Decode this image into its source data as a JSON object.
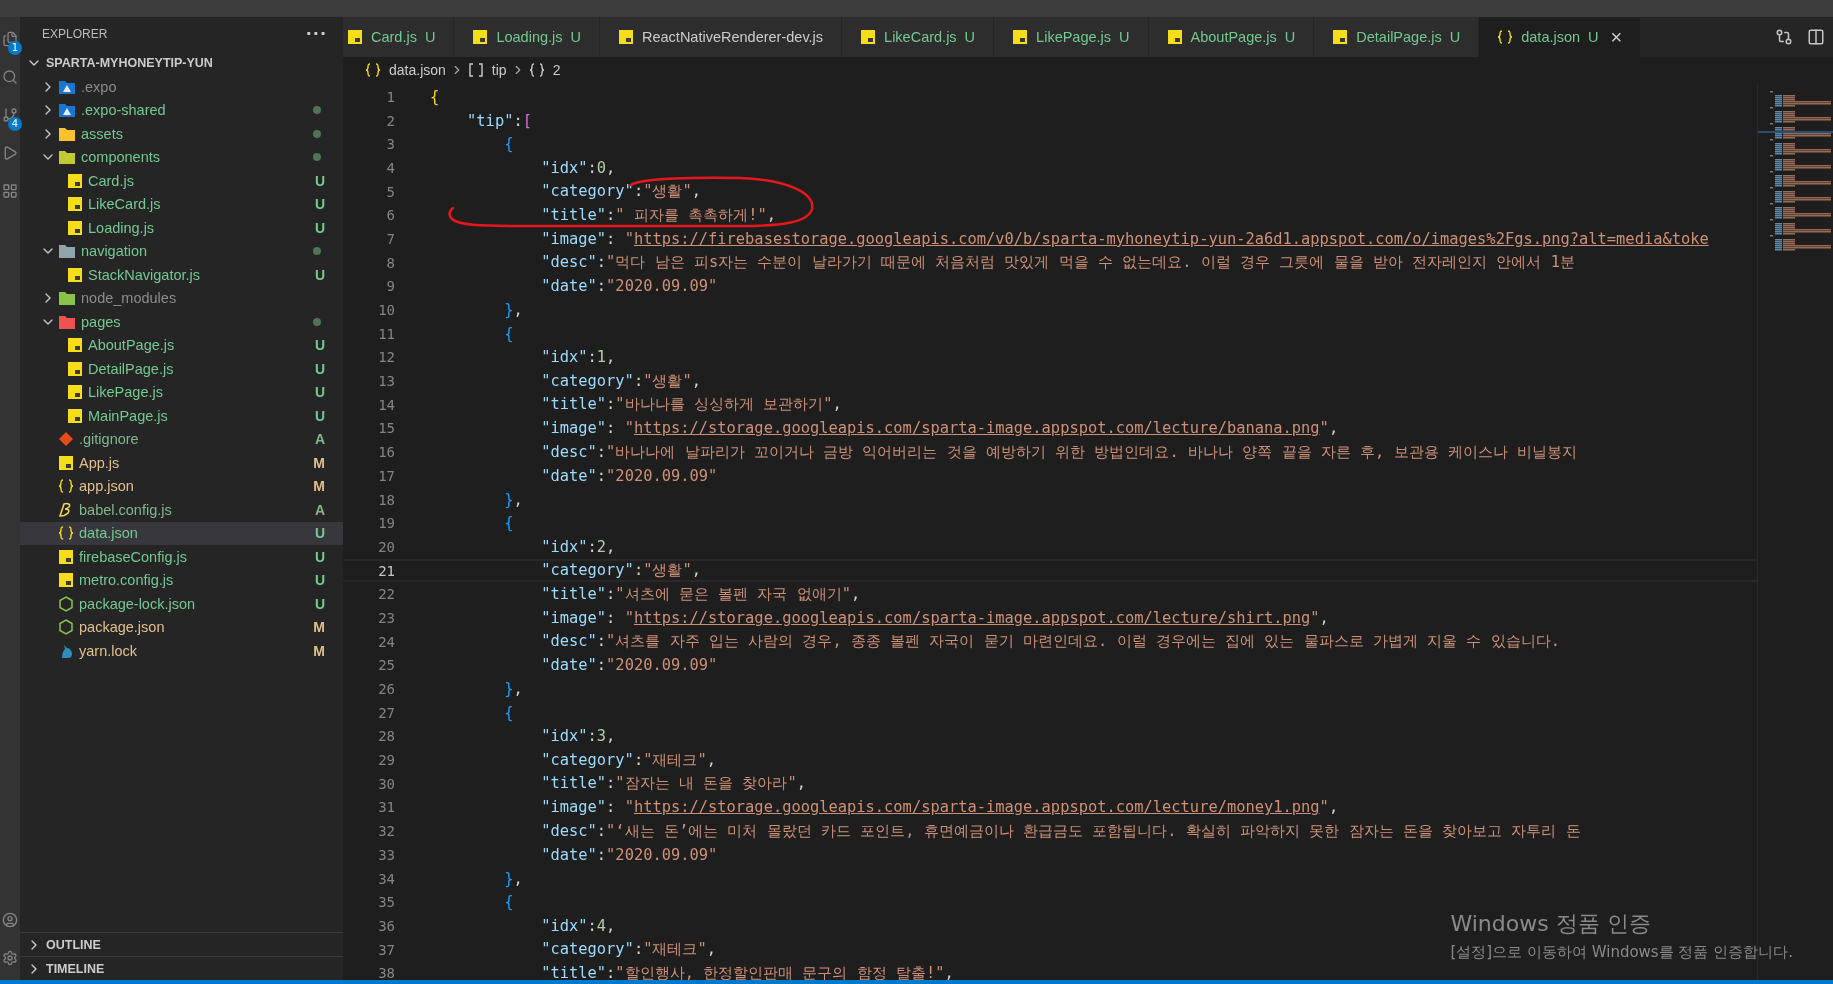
{
  "activity_bar": {
    "badges": [
      "1",
      "4"
    ]
  },
  "explorer": {
    "title": "EXPLORER",
    "more": "···",
    "project": {
      "name": "SPARTA-MYHONEYTIP-YUN",
      "expanded": true
    },
    "tree": [
      {
        "name": ".expo",
        "kind": "folder",
        "expanded": false,
        "color": "#8c8c8c",
        "dot": false,
        "selected": false
      },
      {
        "name": ".expo-shared",
        "kind": "folder",
        "expanded": false,
        "color": "#73c991",
        "dot": true,
        "selected": false
      },
      {
        "name": "assets",
        "kind": "folder",
        "expanded": false,
        "color": "#73c991",
        "dot": true,
        "selected": false
      },
      {
        "name": "components",
        "kind": "folder",
        "expanded": true,
        "color": "#73c991",
        "dot": true,
        "selected": false,
        "children": [
          {
            "name": "Card.js",
            "kind": "js",
            "color": "#73c991",
            "status": "U",
            "selected": false
          },
          {
            "name": "LikeCard.js",
            "kind": "js",
            "color": "#73c991",
            "status": "U",
            "selected": false
          },
          {
            "name": "Loading.js",
            "kind": "js",
            "color": "#73c991",
            "status": "U",
            "selected": false
          }
        ]
      },
      {
        "name": "navigation",
        "kind": "folder",
        "expanded": true,
        "color": "#73c991",
        "dot": true,
        "selected": false,
        "children": [
          {
            "name": "StackNavigator.js",
            "kind": "js",
            "color": "#73c991",
            "status": "U",
            "selected": false
          }
        ]
      },
      {
        "name": "node_modules",
        "kind": "folder",
        "expanded": false,
        "color": "#8c8c8c",
        "dot": false,
        "selected": false
      },
      {
        "name": "pages",
        "kind": "folder",
        "expanded": true,
        "color": "#73c991",
        "dot": true,
        "selected": false,
        "children": [
          {
            "name": "AboutPage.js",
            "kind": "js",
            "color": "#73c991",
            "status": "U",
            "selected": false
          },
          {
            "name": "DetailPage.js",
            "kind": "js",
            "color": "#73c991",
            "status": "U",
            "selected": false
          },
          {
            "name": "LikePage.js",
            "kind": "js",
            "color": "#73c991",
            "status": "U",
            "selected": false
          },
          {
            "name": "MainPage.js",
            "kind": "js",
            "color": "#73c991",
            "status": "U",
            "selected": false
          }
        ]
      },
      {
        "name": ".gitignore",
        "kind": "git",
        "color": "#81b88b",
        "status": "A",
        "selected": false
      },
      {
        "name": "App.js",
        "kind": "js",
        "color": "#e2c08d",
        "status": "M",
        "selected": false
      },
      {
        "name": "app.json",
        "kind": "json",
        "color": "#e2c08d",
        "status": "M",
        "selected": false
      },
      {
        "name": "babel.config.js",
        "kind": "babel",
        "color": "#81b88b",
        "status": "A",
        "selected": false
      },
      {
        "name": "data.json",
        "kind": "json",
        "color": "#73c991",
        "status": "U",
        "selected": true
      },
      {
        "name": "firebaseConfig.js",
        "kind": "js",
        "color": "#73c991",
        "status": "U",
        "selected": false
      },
      {
        "name": "metro.config.js",
        "kind": "js",
        "color": "#73c991",
        "status": "U",
        "selected": false
      },
      {
        "name": "package-lock.json",
        "kind": "npm",
        "color": "#73c991",
        "status": "U",
        "selected": false
      },
      {
        "name": "package.json",
        "kind": "npm",
        "color": "#e2c08d",
        "status": "M",
        "selected": false
      },
      {
        "name": "yarn.lock",
        "kind": "yarn",
        "color": "#e2c08d",
        "status": "M",
        "selected": false
      }
    ],
    "sections": [
      {
        "title": "OUTLINE",
        "expanded": false
      },
      {
        "title": "TIMELINE",
        "expanded": false
      }
    ]
  },
  "tabs": [
    {
      "label": "Card.js",
      "kind": "js",
      "color": "#73c991",
      "status": "U",
      "selected": false
    },
    {
      "label": "Loading.js",
      "kind": "js",
      "color": "#73c991",
      "status": "U",
      "selected": false
    },
    {
      "label": "ReactNativeRenderer-dev.js",
      "kind": "js",
      "color": "#cccccc",
      "selected": false
    },
    {
      "label": "LikeCard.js",
      "kind": "js",
      "color": "#73c991",
      "status": "U",
      "selected": false
    },
    {
      "label": "LikePage.js",
      "kind": "js",
      "color": "#73c991",
      "status": "U",
      "selected": false
    },
    {
      "label": "AboutPage.js",
      "kind": "js",
      "color": "#73c991",
      "status": "U",
      "selected": false
    },
    {
      "label": "DetailPage.js",
      "kind": "js",
      "color": "#73c991",
      "status": "U",
      "selected": false
    },
    {
      "label": "data.json",
      "kind": "json",
      "color": "#73c991",
      "status": "U",
      "selected": true,
      "close": "×"
    }
  ],
  "breadcrumb": [
    {
      "kind": "json",
      "label": "data.json"
    },
    {
      "kind": "array",
      "label": "tip"
    },
    {
      "kind": "object",
      "label": "2"
    }
  ],
  "code": [
    {
      "number": "1",
      "current": false,
      "tokens": [
        {
          "kind": "open",
          "text": "{",
          "color": "#ffd700"
        }
      ]
    },
    {
      "number": "2",
      "current": false,
      "tokens": [
        {
          "kind": "key",
          "text": "\"tip\""
        },
        {
          "kind": "punct",
          "text": ":"
        },
        {
          "kind": "open",
          "text": "[",
          "color": "#da70d6"
        }
      ]
    },
    {
      "number": "3",
      "current": false,
      "tokens": [
        {
          "kind": "open",
          "text": "{",
          "color": "#179fff"
        }
      ]
    },
    {
      "number": "4",
      "current": false,
      "tokens": [
        {
          "kind": "key",
          "text": "\"idx\""
        },
        {
          "kind": "punct",
          "text": ":"
        },
        {
          "kind": "number",
          "text": "0"
        },
        {
          "kind": "punct",
          "text": ","
        }
      ]
    },
    {
      "number": "5",
      "current": false,
      "tokens": [
        {
          "kind": "key",
          "text": "\"category\""
        },
        {
          "kind": "punct",
          "text": ":"
        },
        {
          "kind": "string",
          "text": "\"생활\""
        },
        {
          "kind": "punct",
          "text": ","
        }
      ]
    },
    {
      "number": "6",
      "current": false,
      "tokens": [
        {
          "kind": "key",
          "text": "\"title\""
        },
        {
          "kind": "punct",
          "text": ":"
        },
        {
          "kind": "string",
          "text": "\" 피자를 촉촉하게!\""
        },
        {
          "kind": "punct",
          "text": ","
        }
      ]
    },
    {
      "number": "7",
      "current": false,
      "tokens": [
        {
          "kind": "key",
          "text": "\"image\""
        },
        {
          "kind": "punct",
          "text": ": "
        },
        {
          "kind": "string",
          "text": "\""
        },
        {
          "kind": "link",
          "text": "https://firebasestorage.googleapis.com/v0/b/sparta-myhoneytip-yun-2a6d1.appspot.com/o/images%2Fgs.png?alt=media&toke"
        }
      ]
    },
    {
      "number": "8",
      "current": false,
      "tokens": [
        {
          "kind": "key",
          "text": "\"desc\""
        },
        {
          "kind": "punct",
          "text": ":"
        },
        {
          "kind": "string",
          "text": "\"먹다 남은 피s자는 수분이 날라가기 때문에 처음처럼 맛있게 먹을 수 없는데요. 이럴 경우 그릇에 물을 받아 전자레인지 안에서 1분"
        }
      ]
    },
    {
      "number": "9",
      "current": false,
      "tokens": [
        {
          "kind": "key",
          "text": "\"date\""
        },
        {
          "kind": "punct",
          "text": ":"
        },
        {
          "kind": "string",
          "text": "\"2020.09.09\""
        }
      ]
    },
    {
      "number": "10",
      "current": false,
      "tokens": [
        {
          "kind": "close",
          "text": "}",
          "color": "#179fff"
        },
        {
          "kind": "punct",
          "text": ","
        }
      ]
    },
    {
      "number": "11",
      "current": false,
      "tokens": [
        {
          "kind": "open",
          "text": "{",
          "color": "#179fff"
        }
      ]
    },
    {
      "number": "12",
      "current": false,
      "tokens": [
        {
          "kind": "key",
          "text": "\"idx\""
        },
        {
          "kind": "punct",
          "text": ":"
        },
        {
          "kind": "number",
          "text": "1"
        },
        {
          "kind": "punct",
          "text": ","
        }
      ]
    },
    {
      "number": "13",
      "current": false,
      "tokens": [
        {
          "kind": "key",
          "text": "\"category\""
        },
        {
          "kind": "punct",
          "text": ":"
        },
        {
          "kind": "string",
          "text": "\"생활\""
        },
        {
          "kind": "punct",
          "text": ","
        }
      ]
    },
    {
      "number": "14",
      "current": false,
      "tokens": [
        {
          "kind": "key",
          "text": "\"title\""
        },
        {
          "kind": "punct",
          "text": ":"
        },
        {
          "kind": "string",
          "text": "\"바나나를 싱싱하게 보관하기\""
        },
        {
          "kind": "punct",
          "text": ","
        }
      ]
    },
    {
      "number": "15",
      "current": false,
      "tokens": [
        {
          "kind": "key",
          "text": "\"image\""
        },
        {
          "kind": "punct",
          "text": ": "
        },
        {
          "kind": "string",
          "text": "\""
        },
        {
          "kind": "link",
          "text": "https://storage.googleapis.com/sparta-image.appspot.com/lecture/banana.png"
        },
        {
          "kind": "string",
          "text": "\""
        },
        {
          "kind": "punct",
          "text": ","
        }
      ]
    },
    {
      "number": "16",
      "current": false,
      "tokens": [
        {
          "kind": "key",
          "text": "\"desc\""
        },
        {
          "kind": "punct",
          "text": ":"
        },
        {
          "kind": "string",
          "text": "\"바나나에 날파리가 꼬이거나 금방 익어버리는 것을 예방하기 위한 방법인데요. 바나나 양쪽 끝을 자른 후, 보관용 케이스나 비닐봉지"
        }
      ]
    },
    {
      "number": "17",
      "current": false,
      "tokens": [
        {
          "kind": "key",
          "text": "\"date\""
        },
        {
          "kind": "punct",
          "text": ":"
        },
        {
          "kind": "string",
          "text": "\"2020.09.09\""
        }
      ]
    },
    {
      "number": "18",
      "current": false,
      "tokens": [
        {
          "kind": "close",
          "text": "}",
          "color": "#179fff"
        },
        {
          "kind": "punct",
          "text": ","
        }
      ]
    },
    {
      "number": "19",
      "current": false,
      "tokens": [
        {
          "kind": "open",
          "text": "{",
          "color": "#179fff"
        }
      ]
    },
    {
      "number": "20",
      "current": false,
      "tokens": [
        {
          "kind": "key",
          "text": "\"idx\""
        },
        {
          "kind": "punct",
          "text": ":"
        },
        {
          "kind": "number",
          "text": "2"
        },
        {
          "kind": "punct",
          "text": ","
        }
      ]
    },
    {
      "number": "21",
      "current": true,
      "tokens": [
        {
          "kind": "key",
          "text": "\"category\""
        },
        {
          "kind": "punct",
          "text": ":"
        },
        {
          "kind": "string",
          "text": "\"생활\""
        },
        {
          "kind": "punct",
          "text": ","
        }
      ]
    },
    {
      "number": "22",
      "current": false,
      "tokens": [
        {
          "kind": "key",
          "text": "\"title\""
        },
        {
          "kind": "punct",
          "text": ":"
        },
        {
          "kind": "string",
          "text": "\"셔츠에 묻은 볼펜 자국 없애기\""
        },
        {
          "kind": "punct",
          "text": ","
        }
      ]
    },
    {
      "number": "23",
      "current": false,
      "tokens": [
        {
          "kind": "key",
          "text": "\"image\""
        },
        {
          "kind": "punct",
          "text": ": "
        },
        {
          "kind": "string",
          "text": "\""
        },
        {
          "kind": "link",
          "text": "https://storage.googleapis.com/sparta-image.appspot.com/lecture/shirt.png"
        },
        {
          "kind": "string",
          "text": "\""
        },
        {
          "kind": "punct",
          "text": ","
        }
      ]
    },
    {
      "number": "24",
      "current": false,
      "tokens": [
        {
          "kind": "key",
          "text": "\"desc\""
        },
        {
          "kind": "punct",
          "text": ":"
        },
        {
          "kind": "string",
          "text": "\"셔츠를 자주 입는 사람의 경우, 종종 볼펜 자국이 묻기 마련인데요. 이럴 경우에는 집에 있는 물파스로 가볍게 지울 수 있습니다."
        }
      ]
    },
    {
      "number": "25",
      "current": false,
      "tokens": [
        {
          "kind": "key",
          "text": "\"date\""
        },
        {
          "kind": "punct",
          "text": ":"
        },
        {
          "kind": "string",
          "text": "\"2020.09.09\""
        }
      ]
    },
    {
      "number": "26",
      "current": false,
      "tokens": [
        {
          "kind": "close",
          "text": "}",
          "color": "#179fff"
        },
        {
          "kind": "punct",
          "text": ","
        }
      ]
    },
    {
      "number": "27",
      "current": false,
      "tokens": [
        {
          "kind": "open",
          "text": "{",
          "color": "#179fff"
        }
      ]
    },
    {
      "number": "28",
      "current": false,
      "tokens": [
        {
          "kind": "key",
          "text": "\"idx\""
        },
        {
          "kind": "punct",
          "text": ":"
        },
        {
          "kind": "number",
          "text": "3"
        },
        {
          "kind": "punct",
          "text": ","
        }
      ]
    },
    {
      "number": "29",
      "current": false,
      "tokens": [
        {
          "kind": "key",
          "text": "\"category\""
        },
        {
          "kind": "punct",
          "text": ":"
        },
        {
          "kind": "string",
          "text": "\"재테크\""
        },
        {
          "kind": "punct",
          "text": ","
        }
      ]
    },
    {
      "number": "30",
      "current": false,
      "tokens": [
        {
          "kind": "key",
          "text": "\"title\""
        },
        {
          "kind": "punct",
          "text": ":"
        },
        {
          "kind": "string",
          "text": "\"잠자는 내 돈을 찾아라\""
        },
        {
          "kind": "punct",
          "text": ","
        }
      ]
    },
    {
      "number": "31",
      "current": false,
      "tokens": [
        {
          "kind": "key",
          "text": "\"image\""
        },
        {
          "kind": "punct",
          "text": ": "
        },
        {
          "kind": "string",
          "text": "\""
        },
        {
          "kind": "link",
          "text": "https://storage.googleapis.com/sparta-image.appspot.com/lecture/money1.png"
        },
        {
          "kind": "string",
          "text": "\""
        },
        {
          "kind": "punct",
          "text": ","
        }
      ]
    },
    {
      "number": "32",
      "current": false,
      "tokens": [
        {
          "kind": "key",
          "text": "\"desc\""
        },
        {
          "kind": "punct",
          "text": ":"
        },
        {
          "kind": "string",
          "text": "\"‘새는 돈’에는 미처 몰랐던 카드 포인트, 휴면예금이나 환급금도 포함됩니다. 확실히 파악하지 못한 잠자는 돈을 찾아보고 자투리 돈"
        }
      ]
    },
    {
      "number": "33",
      "current": false,
      "tokens": [
        {
          "kind": "key",
          "text": "\"date\""
        },
        {
          "kind": "punct",
          "text": ":"
        },
        {
          "kind": "string",
          "text": "\"2020.09.09\""
        }
      ]
    },
    {
      "number": "34",
      "current": false,
      "tokens": [
        {
          "kind": "close",
          "text": "}",
          "color": "#179fff"
        },
        {
          "kind": "punct",
          "text": ","
        }
      ]
    },
    {
      "number": "35",
      "current": false,
      "tokens": [
        {
          "kind": "open",
          "text": "{",
          "color": "#179fff"
        }
      ]
    },
    {
      "number": "36",
      "current": false,
      "tokens": [
        {
          "kind": "key",
          "text": "\"idx\""
        },
        {
          "kind": "punct",
          "text": ":"
        },
        {
          "kind": "number",
          "text": "4"
        },
        {
          "kind": "punct",
          "text": ","
        }
      ]
    },
    {
      "number": "37",
      "current": false,
      "tokens": [
        {
          "kind": "key",
          "text": "\"category\""
        },
        {
          "kind": "punct",
          "text": ":"
        },
        {
          "kind": "string",
          "text": "\"재테크\""
        },
        {
          "kind": "punct",
          "text": ","
        }
      ]
    },
    {
      "number": "38",
      "current": false,
      "tokens": [
        {
          "kind": "key",
          "text": "\"title\""
        },
        {
          "kind": "punct",
          "text": ":"
        },
        {
          "kind": "string",
          "text": "\"할인행사, 한정할인판매 문구의 함정 탈출!\""
        },
        {
          "kind": "punct",
          "text": ","
        }
      ]
    }
  ],
  "os_notice": {
    "title": "Windows 정품 인증",
    "message": "[설정]으로 이동하여 Windows를 정품 인증합니다."
  }
}
